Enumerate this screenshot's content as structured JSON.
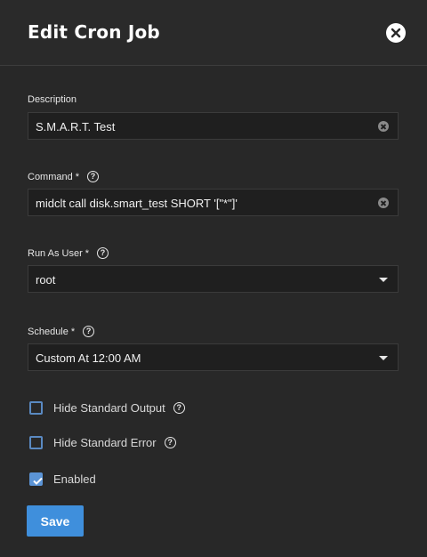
{
  "dialog": {
    "title": "Edit Cron Job",
    "close_icon": "close-icon"
  },
  "fields": {
    "description": {
      "label": "Description",
      "value": "S.M.A.R.T. Test"
    },
    "command": {
      "label": "Command",
      "required_mark": "*",
      "value": "midclt call disk.smart_test SHORT '[\"*\"]'"
    },
    "run_as_user": {
      "label": "Run As User",
      "required_mark": "*",
      "value": "root"
    },
    "schedule": {
      "label": "Schedule",
      "required_mark": "*",
      "value": "Custom At 12:00 AM"
    }
  },
  "options": {
    "hide_stdout": {
      "label": "Hide Standard Output",
      "checked": false
    },
    "hide_stderr": {
      "label": "Hide Standard Error",
      "checked": false
    },
    "enabled": {
      "label": "Enabled",
      "checked": true
    }
  },
  "help_icon_glyph": "?",
  "actions": {
    "save_label": "Save"
  },
  "colors": {
    "accent": "#3f8fdc",
    "background": "#282828",
    "input_bg": "#1f1f1f"
  }
}
